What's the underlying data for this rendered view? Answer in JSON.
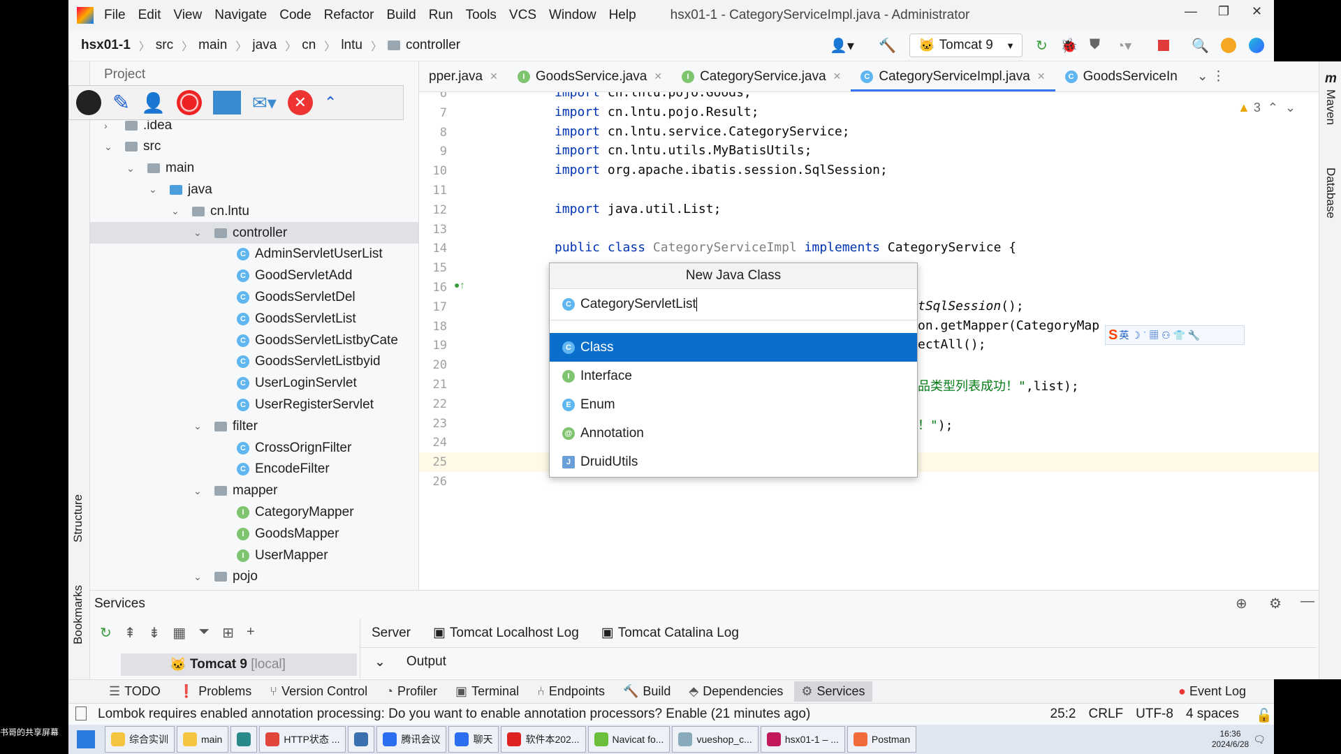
{
  "overlay_left": "书哥的共享屏幕",
  "titlebar": {
    "menus": [
      "File",
      "Edit",
      "View",
      "Navigate",
      "Code",
      "Refactor",
      "Build",
      "Run",
      "Tools",
      "VCS",
      "Window",
      "Help"
    ],
    "title": "hsx01-1 - CategoryServiceImpl.java - Administrator"
  },
  "navbar": {
    "breadcrumb": [
      "hsx01-1",
      "src",
      "main",
      "java",
      "cn",
      "lntu",
      "controller"
    ],
    "run_config": "Tomcat 9"
  },
  "project": {
    "header": "Project",
    "tree": [
      {
        "label": ".idea",
        "depth": 1,
        "type": "folder",
        "arrow": ">"
      },
      {
        "label": "src",
        "depth": 1,
        "type": "folder",
        "arrow": "v"
      },
      {
        "label": "main",
        "depth": 2,
        "type": "folder",
        "arrow": "v"
      },
      {
        "label": "java",
        "depth": 3,
        "type": "folder-blue",
        "arrow": "v"
      },
      {
        "label": "cn.lntu",
        "depth": 4,
        "type": "folder",
        "arrow": "v"
      },
      {
        "label": "controller",
        "depth": 5,
        "type": "folder",
        "arrow": "v",
        "selected": true
      },
      {
        "label": "AdminServletUserList",
        "depth": 6,
        "type": "class"
      },
      {
        "label": "GoodServletAdd",
        "depth": 6,
        "type": "class"
      },
      {
        "label": "GoodsServletDel",
        "depth": 6,
        "type": "class"
      },
      {
        "label": "GoodsServletList",
        "depth": 6,
        "type": "class"
      },
      {
        "label": "GoodsServletListbyCate",
        "depth": 6,
        "type": "class"
      },
      {
        "label": "GoodsServletListbyid",
        "depth": 6,
        "type": "class"
      },
      {
        "label": "UserLoginServlet",
        "depth": 6,
        "type": "class"
      },
      {
        "label": "UserRegisterServlet",
        "depth": 6,
        "type": "class"
      },
      {
        "label": "filter",
        "depth": 5,
        "type": "folder",
        "arrow": "v"
      },
      {
        "label": "CrossOrignFilter",
        "depth": 6,
        "type": "class"
      },
      {
        "label": "EncodeFilter",
        "depth": 6,
        "type": "class"
      },
      {
        "label": "mapper",
        "depth": 5,
        "type": "folder",
        "arrow": "v"
      },
      {
        "label": "CategoryMapper",
        "depth": 6,
        "type": "interface"
      },
      {
        "label": "GoodsMapper",
        "depth": 6,
        "type": "interface"
      },
      {
        "label": "UserMapper",
        "depth": 6,
        "type": "interface"
      },
      {
        "label": "pojo",
        "depth": 5,
        "type": "folder",
        "arrow": "v"
      }
    ]
  },
  "tabs": [
    {
      "label": "pper.java",
      "icon": "none"
    },
    {
      "label": "GoodsService.java",
      "icon": "interface"
    },
    {
      "label": "CategoryService.java",
      "icon": "interface"
    },
    {
      "label": "CategoryServiceImpl.java",
      "icon": "class",
      "active": true
    },
    {
      "label": "GoodsServiceIn",
      "icon": "class"
    }
  ],
  "editor": {
    "warnings": "3",
    "current_line": 25,
    "lines": [
      {
        "n": "6",
        "t": [
          [
            "kw",
            "import "
          ],
          [
            "",
            "cn.lntu.pojo.Goods;"
          ]
        ]
      },
      {
        "n": "7",
        "t": [
          [
            "kw",
            "import "
          ],
          [
            "",
            "cn.lntu.pojo.Result;"
          ]
        ]
      },
      {
        "n": "8",
        "t": [
          [
            "kw",
            "import "
          ],
          [
            "",
            "cn.lntu.service.CategoryService;"
          ]
        ]
      },
      {
        "n": "9",
        "t": [
          [
            "kw",
            "import "
          ],
          [
            "",
            "cn.lntu.utils.MyBatisUtils;"
          ]
        ]
      },
      {
        "n": "10",
        "t": [
          [
            "kw",
            "import "
          ],
          [
            "",
            "org.apache.ibatis.session.SqlSession;"
          ]
        ]
      },
      {
        "n": "11",
        "t": []
      },
      {
        "n": "12",
        "t": [
          [
            "kw",
            "import "
          ],
          [
            "",
            "java.util.List;"
          ]
        ]
      },
      {
        "n": "13",
        "t": []
      },
      {
        "n": "14",
        "t": [
          [
            "kw",
            "public class "
          ],
          [
            "gray",
            "CategoryServiceImpl "
          ],
          [
            "kw",
            "implements "
          ],
          [
            "",
            "CategoryService {"
          ]
        ]
      },
      {
        "n": "15",
        "t": []
      },
      {
        "n": "16",
        "t": []
      },
      {
        "n": "17",
        "t": [],
        "tail": [
          [
            "ital",
            "tSqlSession"
          ],
          [
            "",
            "();"
          ]
        ]
      },
      {
        "n": "18",
        "t": [],
        "tail": [
          [
            "",
            "on.getMapper(CategoryMap"
          ]
        ]
      },
      {
        "n": "19",
        "t": [],
        "tail": [
          [
            "",
            "ectAll();"
          ]
        ]
      },
      {
        "n": "20",
        "t": []
      },
      {
        "n": "21",
        "t": [],
        "tail": [
          [
            "str",
            "品类型列表成功！\""
          ],
          [
            "",
            ",list);"
          ]
        ]
      },
      {
        "n": "22",
        "t": []
      },
      {
        "n": "23",
        "t": [],
        "tail": [
          [
            "str",
            "！\""
          ],
          [
            "",
            ");"
          ]
        ]
      },
      {
        "n": "24",
        "t": []
      },
      {
        "n": "25",
        "t": []
      },
      {
        "n": "26",
        "t": []
      }
    ]
  },
  "popup": {
    "title": "New Java Class",
    "input_value": "CategoryServletList",
    "items": [
      {
        "label": "Class",
        "icon": "class",
        "selected": true
      },
      {
        "label": "Interface",
        "icon": "interface"
      },
      {
        "label": "Enum",
        "icon": "enum"
      },
      {
        "label": "Annotation",
        "icon": "annotation"
      },
      {
        "label": "DruidUtils",
        "icon": "template"
      }
    ]
  },
  "right_strip": [
    "Maven",
    "Database"
  ],
  "left_strip": [
    "Project",
    "Structure",
    "Bookmarks"
  ],
  "services": {
    "title": "Services",
    "tabs": [
      "Server",
      "Tomcat Localhost Log",
      "Tomcat Catalina Log"
    ],
    "tree_item": "Tomcat 9",
    "tree_item_suffix": "[local]",
    "output_label": "Output"
  },
  "bottombar": [
    {
      "label": "TODO"
    },
    {
      "label": "Problems"
    },
    {
      "label": "Version Control"
    },
    {
      "label": "Profiler"
    },
    {
      "label": "Terminal"
    },
    {
      "label": "Endpoints"
    },
    {
      "label": "Build"
    },
    {
      "label": "Dependencies"
    },
    {
      "label": "Services",
      "active": true
    }
  ],
  "event_log": "Event Log",
  "status": {
    "message": "Lombok requires enabled annotation processing: Do you want to enable annotation processors? Enable (21 minutes ago)",
    "position": "25:2",
    "line_sep": "CRLF",
    "encoding": "UTF-8",
    "indent": "4 spaces"
  },
  "taskbar": {
    "items": [
      {
        "label": "综合实训",
        "color": "#f5c542"
      },
      {
        "label": "main",
        "color": "#f5c542"
      },
      {
        "label": "",
        "color": "#2a8a8a"
      },
      {
        "label": "HTTP状态 ...",
        "color": "#e0463b"
      },
      {
        "label": "",
        "color": "#3a6fb0"
      },
      {
        "label": "腾讯会议",
        "color": "#2b6ff0"
      },
      {
        "label": "聊天",
        "color": "#2b6ff0"
      },
      {
        "label": "软件本202...",
        "color": "#d22"
      },
      {
        "label": "Navicat fo...",
        "color": "#6bbf3a"
      },
      {
        "label": "vueshop_c...",
        "color": "#8ab"
      },
      {
        "label": "hsx01-1 – ...",
        "color": "#c2185b"
      },
      {
        "label": "Postman",
        "color": "#f26b3a"
      }
    ],
    "time": "16:36",
    "date": "2024/6/28"
  }
}
